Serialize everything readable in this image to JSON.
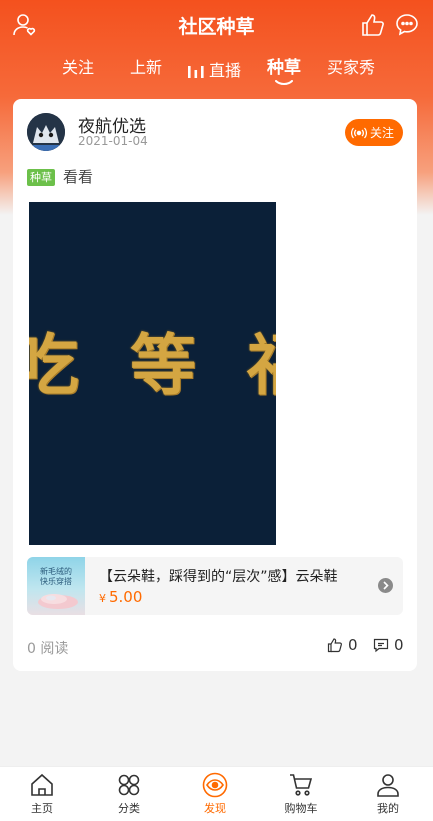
{
  "header": {
    "title": "社区种草",
    "tabs": [
      {
        "label": "关注"
      },
      {
        "label": "上新"
      },
      {
        "label": "直播"
      },
      {
        "label": "种草",
        "active": true
      },
      {
        "label": "买家秀"
      }
    ]
  },
  "post": {
    "author": "夜航优选",
    "date": "2021-01-04",
    "follow_label": "关注",
    "tag": "种草",
    "text": "看看",
    "media_text": "吃 等 福"
  },
  "product": {
    "title": "【云朵鞋，踩得到的“层次”感】云朵鞋",
    "currency": "¥",
    "price": "5.00",
    "thumb_caption": "新毛绒的 快乐穿搭"
  },
  "stats": {
    "read_count": "0 阅读",
    "likes": "0",
    "comments": "0"
  },
  "bottom_nav": [
    {
      "label": "主页",
      "icon": "home-icon"
    },
    {
      "label": "分类",
      "icon": "category-icon"
    },
    {
      "label": "发现",
      "icon": "eye-icon",
      "active": true
    },
    {
      "label": "购物车",
      "icon": "cart-icon"
    },
    {
      "label": "我的",
      "icon": "user-icon"
    }
  ],
  "colors": {
    "brand": "#f4511e",
    "accent": "#ff6a00",
    "tag_green": "#6cc04a"
  }
}
